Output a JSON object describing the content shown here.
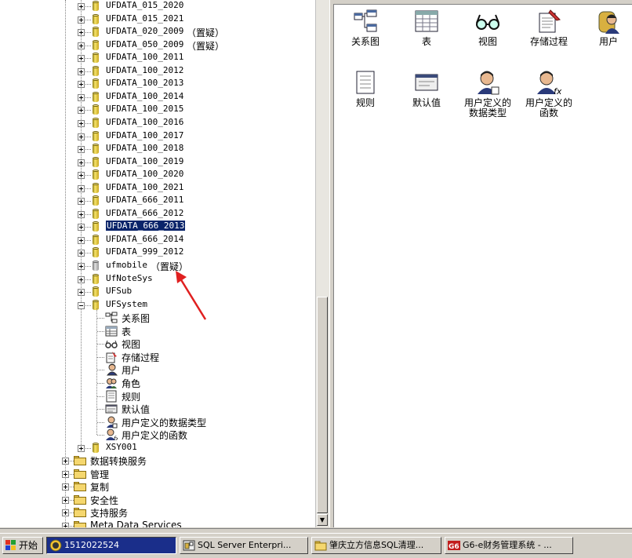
{
  "tree": {
    "databases": [
      {
        "name": "UFDATA_015_2020",
        "note": ""
      },
      {
        "name": "UFDATA_015_2021",
        "note": ""
      },
      {
        "name": "UFDATA_020_2009",
        "note": "（置疑）"
      },
      {
        "name": "UFDATA_050_2009",
        "note": "（置疑）"
      },
      {
        "name": "UFDATA_100_2011",
        "note": ""
      },
      {
        "name": "UFDATA_100_2012",
        "note": ""
      },
      {
        "name": "UFDATA_100_2013",
        "note": ""
      },
      {
        "name": "UFDATA_100_2014",
        "note": ""
      },
      {
        "name": "UFDATA_100_2015",
        "note": ""
      },
      {
        "name": "UFDATA_100_2016",
        "note": ""
      },
      {
        "name": "UFDATA_100_2017",
        "note": ""
      },
      {
        "name": "UFDATA_100_2018",
        "note": ""
      },
      {
        "name": "UFDATA_100_2019",
        "note": ""
      },
      {
        "name": "UFDATA_100_2020",
        "note": ""
      },
      {
        "name": "UFDATA_100_2021",
        "note": ""
      },
      {
        "name": "UFDATA_666_2011",
        "note": ""
      },
      {
        "name": "UFDATA_666_2012",
        "note": ""
      },
      {
        "name": "UFDATA_666_2013",
        "note": "",
        "selected": true
      },
      {
        "name": "UFDATA_666_2014",
        "note": ""
      },
      {
        "name": "UFDATA_999_2012",
        "note": ""
      },
      {
        "name": "ufmobile",
        "note": "（置疑）"
      },
      {
        "name": "UfNoteSys",
        "note": ""
      },
      {
        "name": "UFSub",
        "note": ""
      },
      {
        "name": "UFSystem",
        "note": "",
        "expanded": true
      }
    ],
    "ufsystem_children": [
      "关系图",
      "表",
      "视图",
      "存储过程",
      "用户",
      "角色",
      "规则",
      "默认值",
      "用户定义的数据类型",
      "用户定义的函数"
    ],
    "after_db": "XSY001",
    "folders": [
      "数据转换服务",
      "管理",
      "复制",
      "安全性",
      "支持服务",
      "Meta Data Services"
    ]
  },
  "right_pane": {
    "items_row1": [
      "关系图",
      "表",
      "视图",
      "存储过程",
      "用户"
    ],
    "items_row2": [
      "规则",
      "默认值",
      "用户定义的\n数据类型",
      "用户定义的\n函数"
    ]
  },
  "taskbar": {
    "start_label": "开始",
    "tasks": [
      {
        "label": "1512022524",
        "active": true
      },
      {
        "label": "SQL Server Enterpri...",
        "active": false
      },
      {
        "label": "肇庆立方信息SQL清理...",
        "active": false
      },
      {
        "label": "G6-e财务管理系统 - ...",
        "active": false
      }
    ]
  }
}
